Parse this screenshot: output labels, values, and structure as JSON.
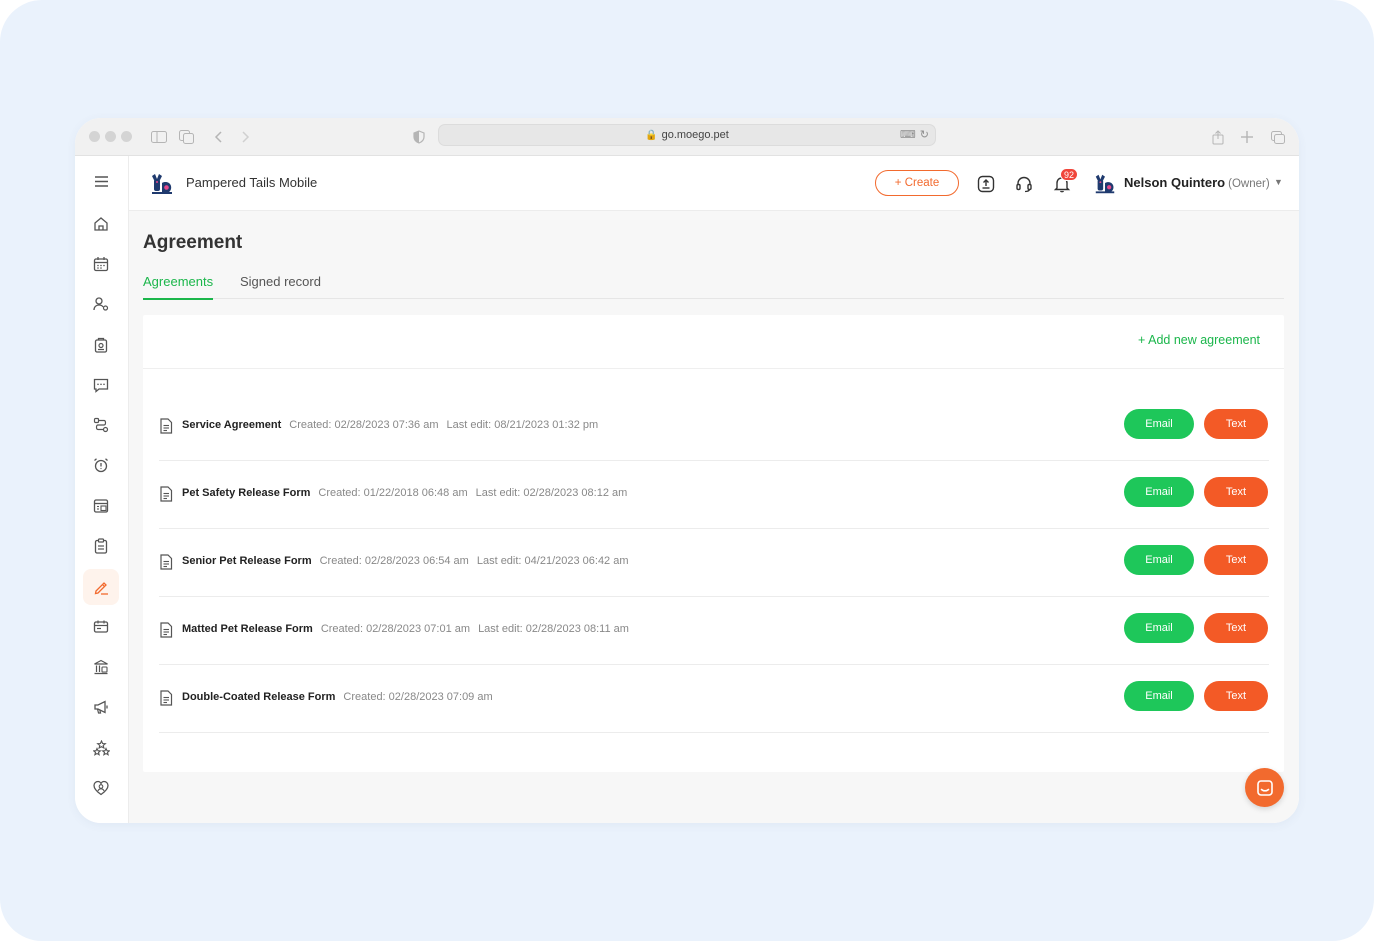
{
  "browser": {
    "url": "go.moego.pet"
  },
  "header": {
    "business_name": "Pampered Tails Mobile",
    "create_label": "+ Create",
    "notification_count": "92",
    "user_name": "Nelson Quintero",
    "user_role": "(Owner)"
  },
  "page": {
    "title": "Agreement",
    "tabs": [
      {
        "label": "Agreements",
        "active": true
      },
      {
        "label": "Signed record",
        "active": false
      }
    ],
    "add_link": "+ Add new agreement"
  },
  "agreements": [
    {
      "name": "Service Agreement",
      "created": "Created: 02/28/2023 07:36 am",
      "last_edit": "Last edit: 08/21/2023 01:32 pm"
    },
    {
      "name": "Pet Safety Release Form",
      "created": "Created: 01/22/2018 06:48 am",
      "last_edit": "Last edit: 02/28/2023 08:12 am"
    },
    {
      "name": "Senior Pet Release Form",
      "created": "Created: 02/28/2023 06:54 am",
      "last_edit": "Last edit: 04/21/2023 06:42 am"
    },
    {
      "name": "Matted Pet Release Form",
      "created": "Created: 02/28/2023 07:01 am",
      "last_edit": "Last edit: 02/28/2023 08:11 am"
    },
    {
      "name": "Double-Coated Release Form",
      "created": "Created: 02/28/2023 07:09 am",
      "last_edit": ""
    }
  ],
  "buttons": {
    "email_label": "Email",
    "text_label": "Text"
  },
  "colors": {
    "accent_green": "#1ec75a",
    "accent_orange": "#f35a26",
    "active_nav_bg": "#fef3ec"
  },
  "nav_icons": [
    "menu-icon",
    "home-icon",
    "calendar-icon",
    "clients-icon",
    "lodging-icon",
    "messages-icon",
    "route-icon",
    "reminder-icon",
    "booking-icon",
    "clipboard-icon",
    "agreement-icon",
    "payroll-icon",
    "finance-icon",
    "marketing-icon",
    "reviews-icon",
    "loyalty-icon"
  ]
}
